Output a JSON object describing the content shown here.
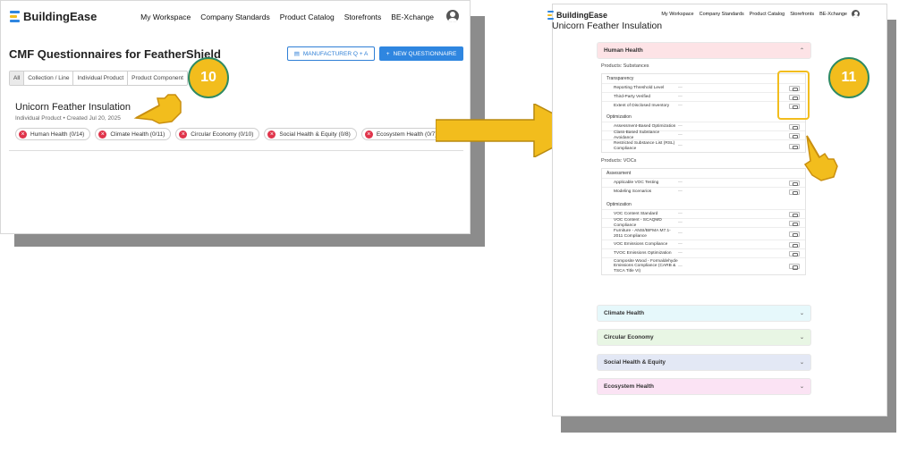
{
  "brand": {
    "name": "BuildingEase",
    "colors": [
      "#2f86e0",
      "#f2bd1d",
      "#e0344b",
      "#2e8a63"
    ]
  },
  "nav": {
    "links": [
      "My Workspace",
      "Company Standards",
      "Product Catalog",
      "Storefronts",
      "BE-Xchange"
    ],
    "avatar_icon": "user-avatar-icon"
  },
  "left": {
    "title": "CMF Questionnaires for FeatherShield",
    "manufacturer_button": "MANUFACTURER Q + A",
    "new_button": "NEW QUESTIONNAIRE",
    "filters": [
      "All",
      "Collection / Line",
      "Individual Product",
      "Product Component"
    ],
    "product": {
      "name": "Unicorn Feather Insulation",
      "meta": "Individual Product • Created Jul 20, 2025",
      "chips": [
        "Human Health (0/14)",
        "Climate Health (0/11)",
        "Circular Economy (0/10)",
        "Social Health & Equity (0/8)",
        "Ecosystem Health (0/7)"
      ]
    }
  },
  "steps": {
    "first": "10",
    "second": "11"
  },
  "right": {
    "title": "Unicorn Feather Insulation",
    "human_health": {
      "label": "Human Health",
      "substances_label": "Products: Substances",
      "transparency": {
        "title": "Transparency",
        "rows": [
          "Reporting Threshold Level",
          "Third-Party Verified",
          "Extent of Disclosed Inventory"
        ]
      },
      "optimization": {
        "title": "Optimization",
        "rows": [
          "Assessment-Based Optimization",
          "Class-Based Substance Avoidance",
          "Restricted Substance List (RSL) Compliance"
        ]
      },
      "vocs_label": "Products: VOCs",
      "assessment": {
        "title": "Assessment",
        "rows": [
          "Applicable VOC Testing",
          "Modeling Scenarios"
        ]
      },
      "optimization2": {
        "title": "Optimization",
        "rows": [
          "VOC Content Standard",
          "VOC Content - SCAQMD Compliance",
          "Furniture - ANSI/BIFMA M7.1-2011 Compliance",
          "VOC Emissions Compliance",
          "TVOC Emissions Optimization",
          "Composite Wood - Formaldehyde Emissions Compliance (CARB & TSCA Title VI)"
        ]
      },
      "dash": "—"
    },
    "sections": [
      "Climate Health",
      "Circular Economy",
      "Social Health & Equity",
      "Ecosystem Health"
    ]
  }
}
